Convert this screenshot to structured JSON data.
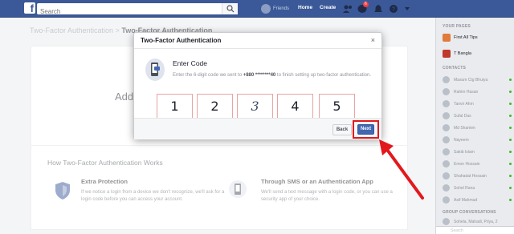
{
  "topbar": {
    "search_placeholder": "Search",
    "profile_name": "Friends",
    "home": "Home",
    "create": "Create",
    "notification_count": "6"
  },
  "breadcrumb": {
    "parent": "Two-Factor Authentication",
    "separator": ">",
    "current": "Two-Factor Authentication"
  },
  "page": {
    "add_text": "Add",
    "how_title": "How Two-Factor Authentication Works",
    "features": [
      {
        "title": "Extra Protection",
        "text": "If we notice a login from a device we don't recognize, we'll ask for a login code before you can access your account."
      },
      {
        "title": "Through SMS or an Authentication App",
        "text": "We'll send a text message with a login code, or you can use a security app of your choice."
      }
    ]
  },
  "dialog": {
    "title": "Two-Factor Authentication",
    "close": "×",
    "heading": "Enter Code",
    "desc_prefix": "Enter the 6-digit code we sent to ",
    "phone": "+880 ********40",
    "desc_suffix": " to finish setting up two-factor authentication.",
    "codes": [
      "1",
      "2",
      "3",
      "4",
      "5"
    ],
    "back_label": "Back",
    "next_label": "Next"
  },
  "sidebar": {
    "pages_head": "YOUR PAGES",
    "pages": [
      {
        "name": "First All Tips",
        "color": "#e07b39"
      },
      {
        "name": "T Bangla",
        "color": "#c0392b"
      }
    ],
    "contacts_head": "CONTACTS",
    "contacts": [
      "Masum Ctg Bhuiya",
      "Rahim Hasan",
      "Tanvir Ahm",
      "Sufal Das",
      "Md Shamim",
      "Nayeem",
      "Sakib Islam",
      "Emon Hossain",
      "Shahadat Hossain",
      "Sohel Rana",
      "Asif Mahmud"
    ],
    "group_head": "GROUP CONVERSATIONS",
    "group": "Sohela, Mahadi, Priya, 2",
    "search_placeholder": "Search"
  },
  "colors": {
    "brand": "#3b5998",
    "button": "#4267b2",
    "highlight": "#e3181d"
  }
}
